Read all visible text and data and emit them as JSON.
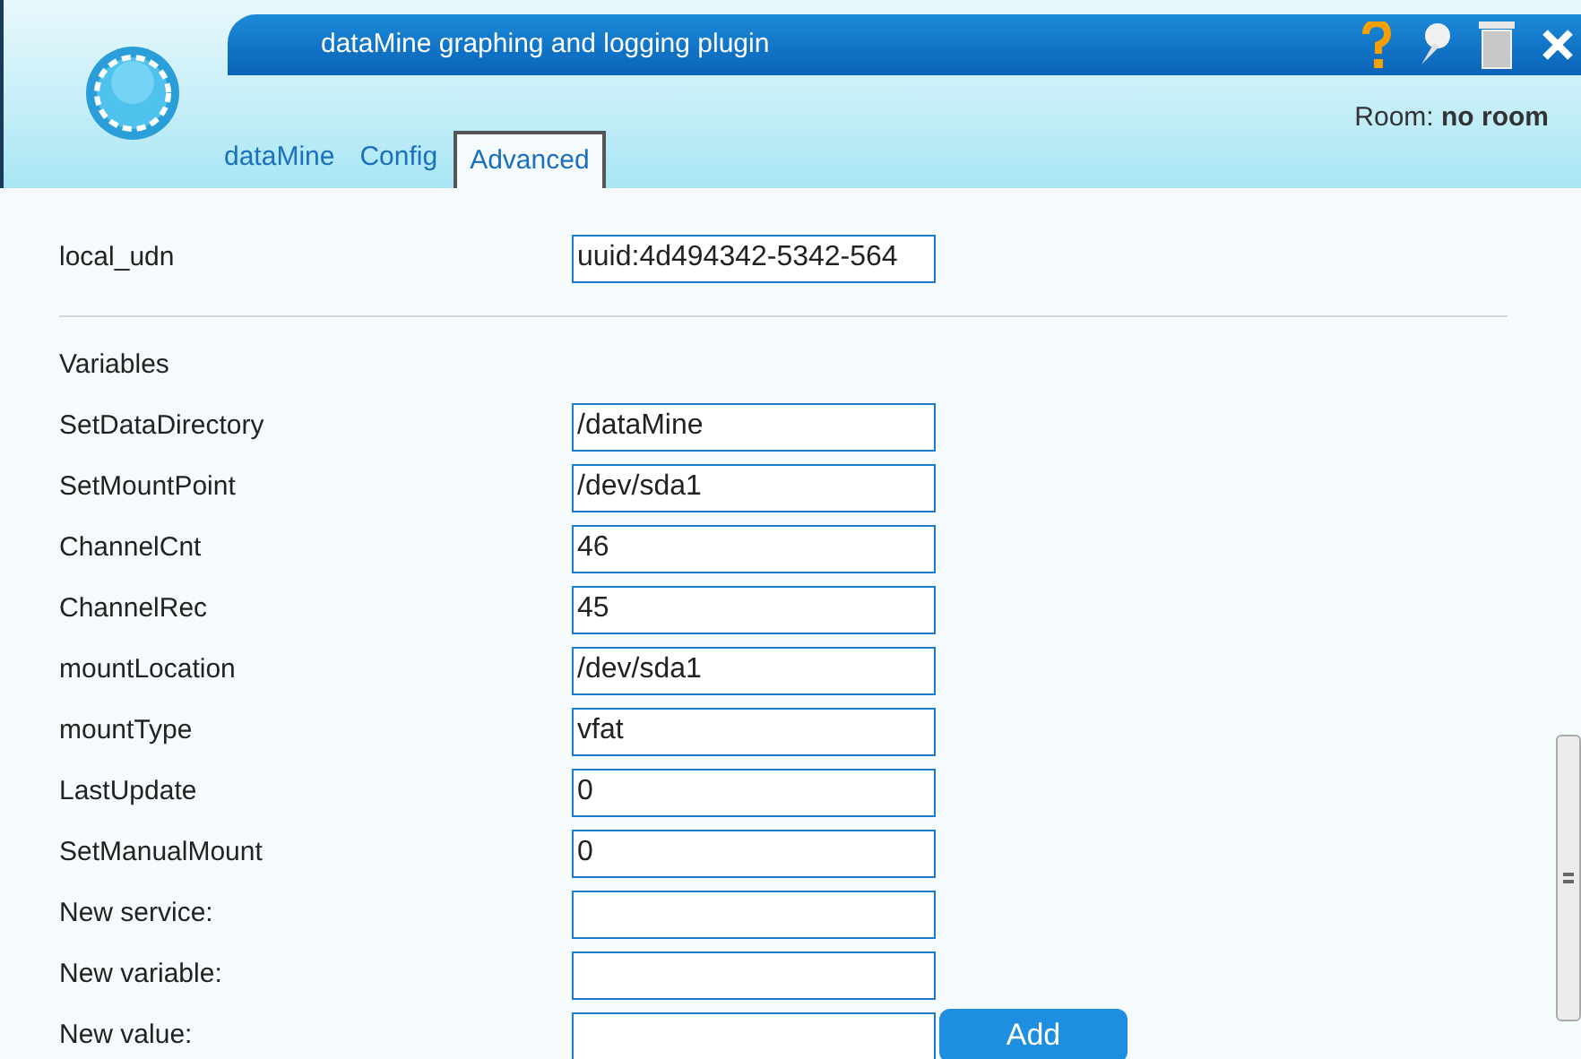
{
  "window": {
    "title": "dataMine graphing and logging plugin"
  },
  "room": {
    "label": "Room:",
    "value": "no room"
  },
  "tabs": [
    {
      "label": "dataMine",
      "selected": false
    },
    {
      "label": "Config",
      "selected": false
    },
    {
      "label": "Advanced",
      "selected": true
    }
  ],
  "device_fields": [
    {
      "label": "local_udn",
      "value": "uuid:4d494342-5342-564"
    }
  ],
  "variables_heading": "Variables",
  "variables": [
    {
      "label": "SetDataDirectory",
      "value": "/dataMine"
    },
    {
      "label": "SetMountPoint",
      "value": "/dev/sda1"
    },
    {
      "label": "ChannelCnt",
      "value": "46"
    },
    {
      "label": "ChannelRec",
      "value": "45"
    },
    {
      "label": "mountLocation",
      "value": "/dev/sda1"
    },
    {
      "label": "mountType",
      "value": "vfat"
    },
    {
      "label": "LastUpdate",
      "value": "0"
    },
    {
      "label": "SetManualMount",
      "value": "0"
    },
    {
      "label": "New service:"
    },
    {
      "label": "New variable:"
    },
    {
      "label": "New value:"
    }
  ],
  "add_button": "Add"
}
